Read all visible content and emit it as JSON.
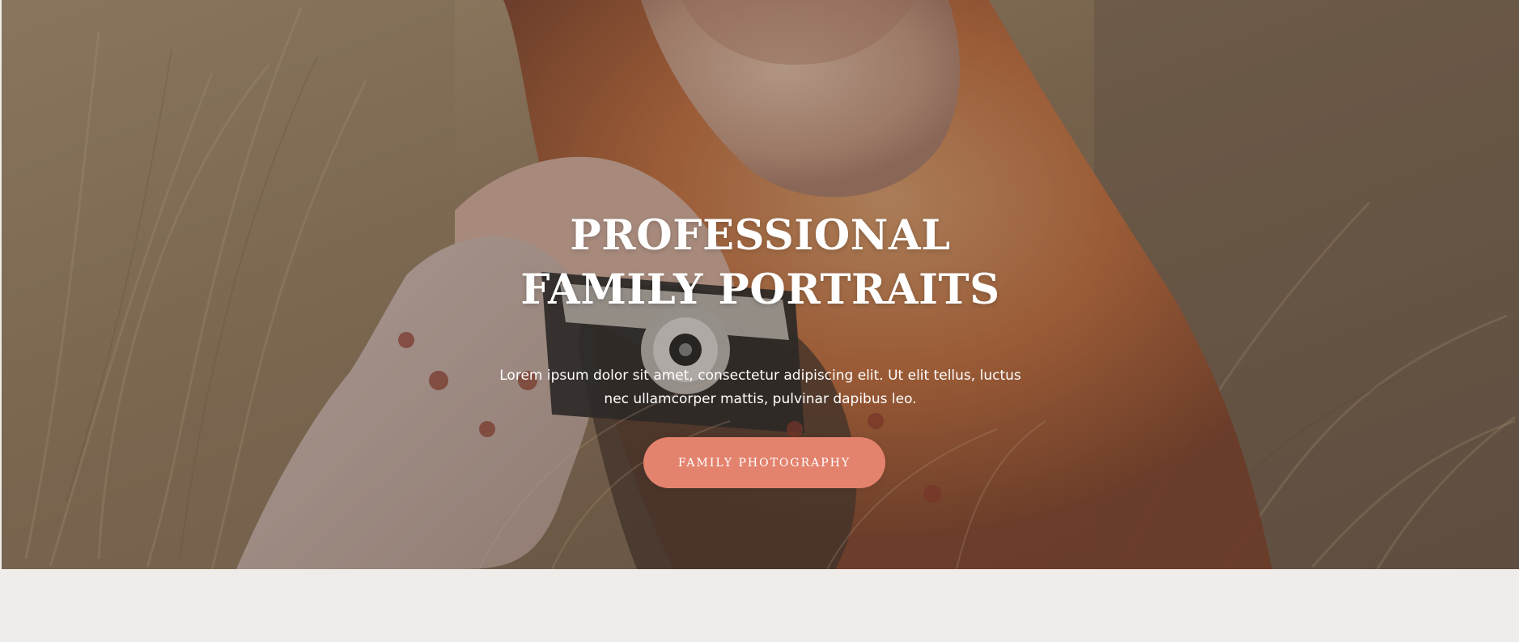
{
  "hero": {
    "title_line_1": "PROFESSIONAL",
    "title_line_2": "FAMILY PORTRAITS",
    "description": "Lorem ipsum dolor sit amet, consectetur adipiscing elit. Ut elit tellus, luctus nec ullamcorper mattis, pulvinar dapibus leo.",
    "button_label": "FAMILY PHOTOGRAPHY"
  },
  "colors": {
    "button": "#e3826d",
    "page_background": "#efecea",
    "hero_text": "#ffffff"
  },
  "icons": {
    "camera": "camera-icon"
  }
}
